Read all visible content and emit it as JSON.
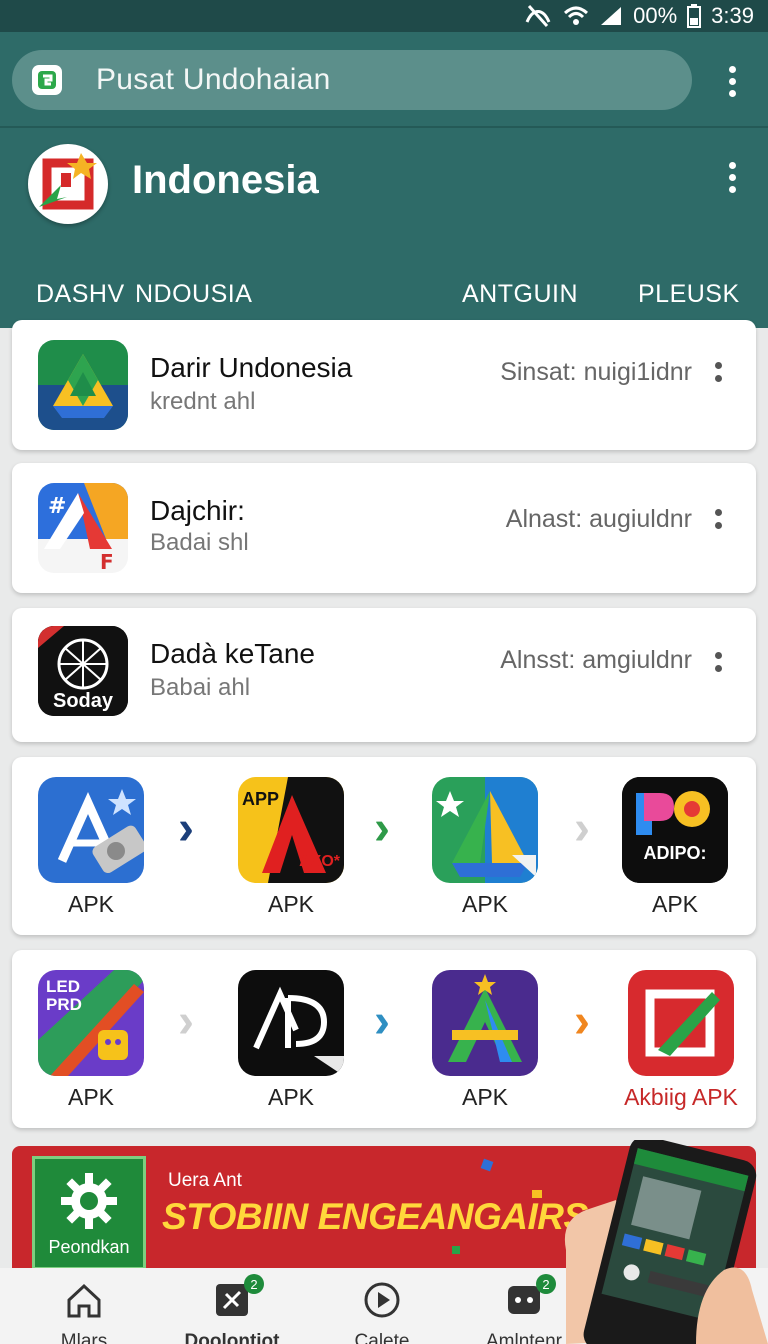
{
  "status_bar": {
    "battery": "00%",
    "time": "3:39"
  },
  "search": {
    "text": "Pusat Undohaian"
  },
  "header": {
    "title": "Indonesia"
  },
  "tabs": [
    {
      "label": "DASHV"
    },
    {
      "label": "NDOUSIA"
    },
    {
      "label": "ANTGUIN"
    },
    {
      "label": "PLEUSK"
    }
  ],
  "list": [
    {
      "title": "Darir Undonesia",
      "subtitle": "krednt ahl",
      "meta": "Sinsat: nuigi1idnr"
    },
    {
      "title": "Dajchir:",
      "subtitle": "Badai shl",
      "meta": "Alnast: augiuldnr"
    },
    {
      "title": "Dadà keTane",
      "subtitle": "Babai ahl",
      "meta": "Alnsst: amgiuldnr",
      "icon_text": "Soday"
    }
  ],
  "grid_row_1": [
    {
      "label": "APK"
    },
    {
      "label": "APK",
      "icon_top": "APP",
      "icon_bottom": "AXO*"
    },
    {
      "label": "APK"
    },
    {
      "label": "APK",
      "icon_text": "ADIPO:"
    }
  ],
  "grid_row_2": [
    {
      "label": "APK",
      "icon_text": "LED PRD"
    },
    {
      "label": "APK"
    },
    {
      "label": "APK"
    },
    {
      "label": "Akbiig APK"
    }
  ],
  "banner": {
    "gear_label": "Peondkan",
    "small_text": "Uera Ant",
    "headline": "STOBIIN ENGEANGAIRS"
  },
  "bottom_nav": [
    {
      "label": "Mlars"
    },
    {
      "label": "Doolontiot",
      "badge": "2"
    },
    {
      "label": "Calete"
    },
    {
      "label": "Amlntenr",
      "badge": "2"
    }
  ],
  "colors": {
    "header": "#2e6b68",
    "search_bg": "#5c8f8b",
    "banner": "#c8272c",
    "badge": "#1e8b3b"
  }
}
